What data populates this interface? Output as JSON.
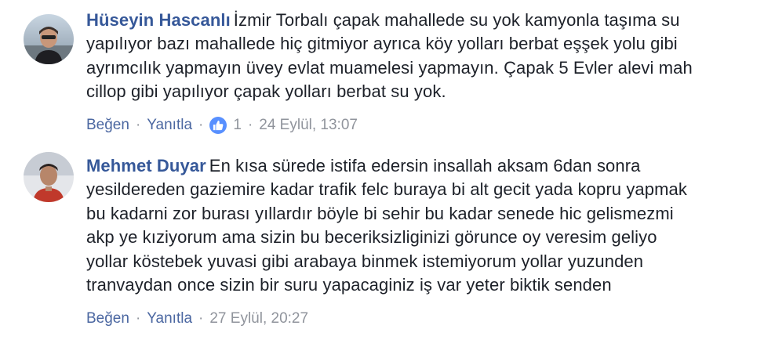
{
  "comments": [
    {
      "author": "Hüseyin Hascanlı",
      "lines": [
        "İzmir Torbalı çapak mahallede su yok kamyonla taşıma su",
        "yapılıyor bazı mahallede hiç gitmiyor ayrıca köy yolları berbat eşşek yolu gibi",
        "ayrımcılık yapmayın üvey evlat muamelesi yapmayın. Çapak 5 Evler alevi mah",
        "cillop gibi yapılıyor çapak yolları berbat su yok."
      ],
      "like_label": "Beğen",
      "reply_label": "Yanıtla",
      "sep": "·",
      "reaction_count": "1",
      "timestamp": "24 Eylül, 13:07"
    },
    {
      "author": "Mehmet Duyar",
      "lines": [
        "En kısa sürede istifa edersin insallah aksam 6dan sonra",
        "yesildereden gaziemire kadar trafik felc buraya bi alt gecit yada kopru yapmak",
        "bu kadarni zor burası yıllardır böyle bi sehir bu kadar senede hic gelismezmi",
        "akp ye kıziyorum ama sizin bu beceriksizliginizi görunce oy veresim geliyo",
        "yollar köstebek yuvasi gibi arabaya binmek istemiyorum yollar yuzunden",
        "tranvaydan once sizin bir suru yapacaginiz iş var yeter biktik senden"
      ],
      "like_label": "Beğen",
      "reply_label": "Yanıtla",
      "sep": "·",
      "timestamp": "27 Eylül, 20:27"
    }
  ],
  "colors": {
    "author": "#365899",
    "link": "#4b67a1",
    "meta": "#90949c",
    "like_badge": "#5890ff"
  },
  "icons": {
    "reaction": "thumbs-up-icon"
  }
}
